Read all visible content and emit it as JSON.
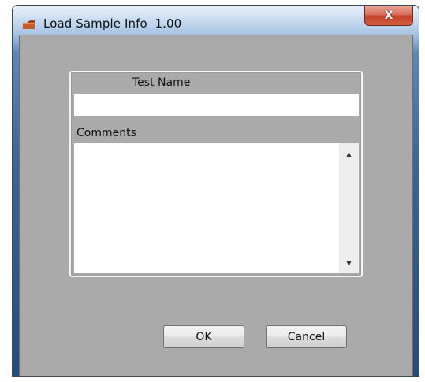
{
  "window": {
    "title": "Load Sample Info  1.00",
    "app_icon": "app-icon",
    "close_icon": "close-icon",
    "close_label": "X"
  },
  "form": {
    "test_name_label": "Test Name",
    "test_name_value": "",
    "comments_label": "Comments",
    "comments_value": ""
  },
  "scrollbar": {
    "up_icon": "scroll-up-icon",
    "up_glyph": "▲",
    "down_icon": "scroll-down-icon",
    "down_glyph": "▼"
  },
  "buttons": {
    "ok_label": "OK",
    "cancel_label": "Cancel"
  },
  "colors": {
    "client_background": "#aaaaaa",
    "input_background": "#ffffff",
    "close_button": "#c2412b"
  }
}
